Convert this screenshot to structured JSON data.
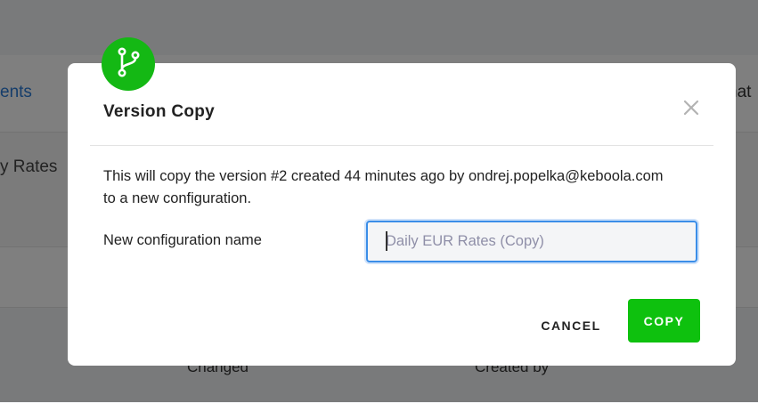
{
  "background": {
    "tab_partial": "ents",
    "row_partial": "y Rates",
    "right_partial": "nat",
    "col_changed": "Changed",
    "col_created_by": "Created by"
  },
  "modal": {
    "icon": "branch-icon",
    "title": "Version Copy",
    "close_icon": "close-icon",
    "message_line1": "This will copy the version #2 created 44 minutes ago by ondrej.popelka@keboola.com",
    "message_line2": "to a new configuration.",
    "field_label": "New configuration name",
    "input_value": "",
    "input_placeholder": "Daily EUR Rates (Copy)",
    "cancel_label": "CANCEL",
    "copy_label": "COPY"
  },
  "colors": {
    "accent_green": "#0ec10e",
    "focus_blue": "#3b8ee8",
    "link_blue": "#2a7bd6"
  }
}
